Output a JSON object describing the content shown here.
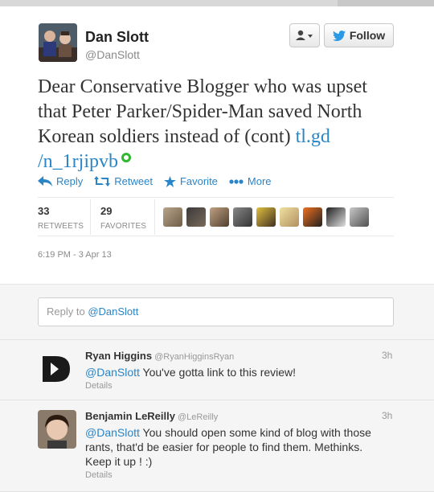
{
  "tweet": {
    "author_name": "Dan Slott",
    "author_handle": "@DanSlott",
    "text": "Dear Conservative Blogger who was upset that Peter Parker/Spider-Man saved North Korean soldiers instead of (cont) ",
    "link_text": "tl.gd /n_1rjipvb",
    "follow_label": "Follow",
    "actions": {
      "reply": "Reply",
      "retweet": "Retweet",
      "favorite": "Favorite",
      "more": "More"
    },
    "stats": {
      "retweets_count": "33",
      "retweets_label": "RETWEETS",
      "favorites_count": "29",
      "favorites_label": "FAVORITES"
    },
    "timestamp": "6:19 PM - 3 Apr 13",
    "colors": {
      "link": "#2a85c7",
      "follow_bird": "#2a9ae6"
    }
  },
  "reply_box": {
    "prefix": "Reply to ",
    "mention": "@DanSlott"
  },
  "replies": [
    {
      "name": "Ryan Higgins",
      "handle": "@RyanHigginsRyan",
      "time": "3h",
      "mention": "@DanSlott",
      "text": " You've gotta link to this review!",
      "details": "Details"
    },
    {
      "name": "Benjamin LeReilly",
      "handle": "@LeReilly",
      "time": "3h",
      "mention": "@DanSlott",
      "text": " You should open some kind of blog with those rants, that'd be easier for people to find them. Methinks. Keep it up ! :)",
      "details": "Details"
    }
  ]
}
